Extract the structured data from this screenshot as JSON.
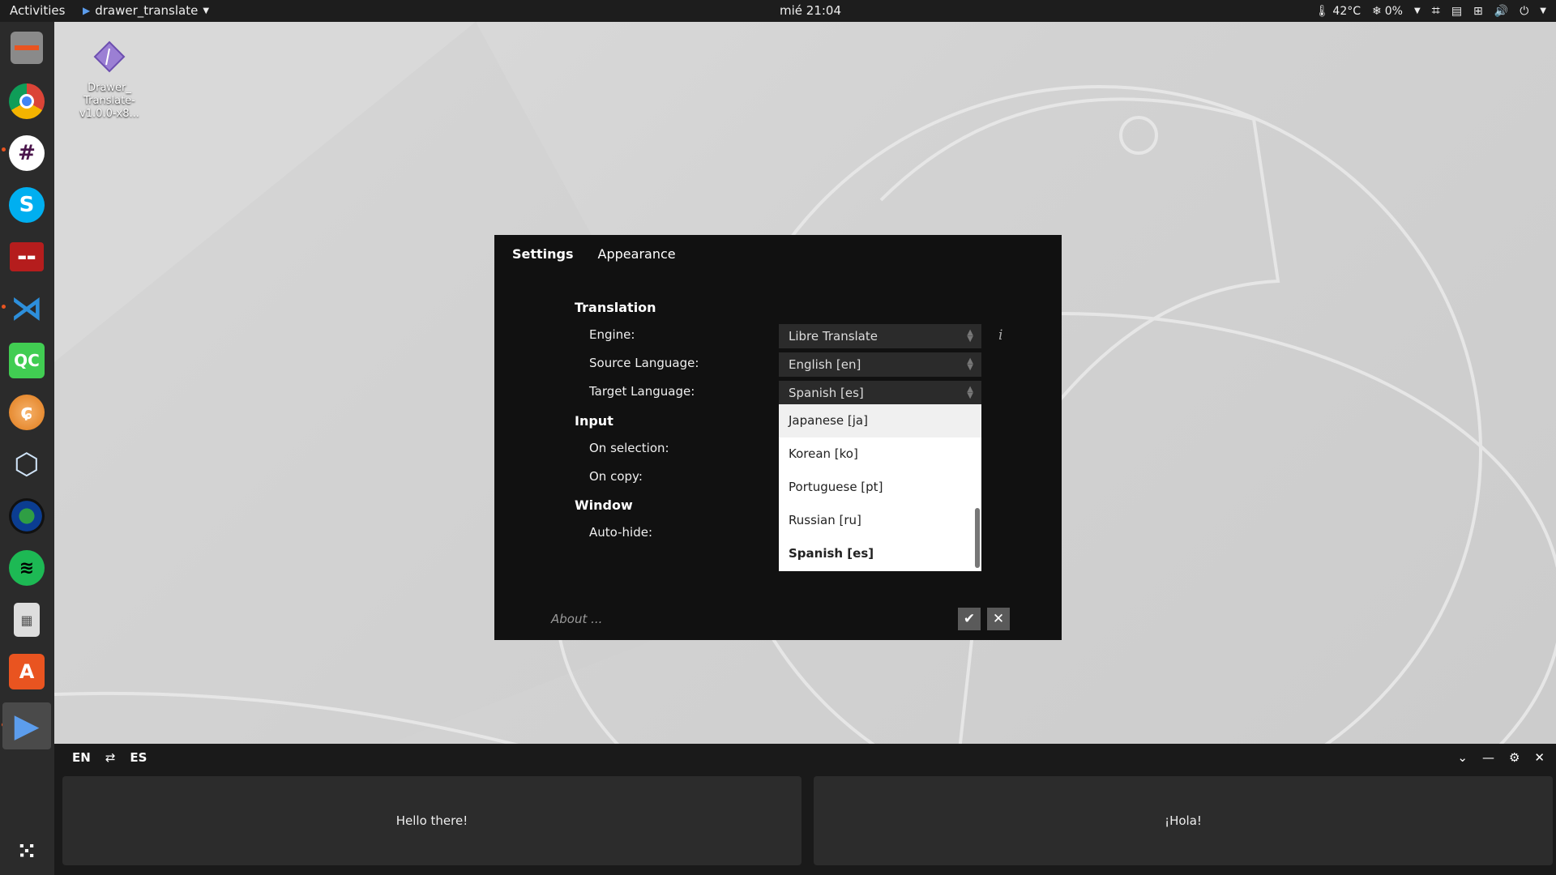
{
  "topbar": {
    "activities": "Activities",
    "app_name": "drawer_translate",
    "clock": "mié 21:04",
    "temp": "42°C",
    "fan": "0%"
  },
  "desktop_icon": {
    "label_line1": "Drawer_",
    "label_line2": "Translate-",
    "label_line3": "v1.0.0-x8..."
  },
  "settings": {
    "tabs": [
      "Settings",
      "Appearance"
    ],
    "sections": {
      "translation": "Translation",
      "input": "Input",
      "window": "Window"
    },
    "labels": {
      "engine": "Engine:",
      "source": "Source Language:",
      "target": "Target Language:",
      "on_selection": "On selection:",
      "on_copy": "On copy:",
      "auto_hide": "Auto-hide:"
    },
    "values": {
      "engine": "Libre Translate",
      "source": "English [en]",
      "target": "Spanish [es]"
    },
    "info": "i",
    "dropdown_options": [
      "Japanese [ja]",
      "Korean [ko]",
      "Portuguese [pt]",
      "Russian [ru]",
      "Spanish [es]"
    ],
    "about": "About ..."
  },
  "drawer": {
    "src_lang": "EN",
    "swap": "⇄",
    "tgt_lang": "ES",
    "source_text": "Hello there!",
    "target_text": "¡Hola!"
  },
  "colors": {
    "topbar": "#1d1d1d",
    "dock": "#2b2b2b",
    "dialog": "#111111",
    "accent": "#e95420"
  }
}
